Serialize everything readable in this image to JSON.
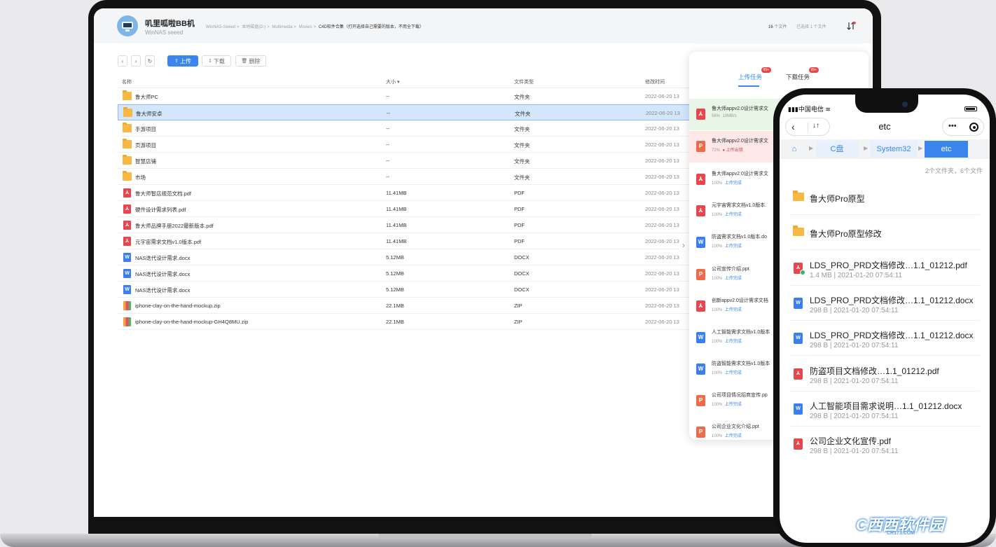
{
  "app": {
    "device_name": "叽里呱啦BB机",
    "device_sub": "WinNAS seeed",
    "breadcrumb": [
      "WinNAS-Seeed",
      "本地磁盘(D:)",
      "Multimedia",
      "Movies"
    ],
    "breadcrumb_current": "C4D软件合集（打开选择自己需要的版本，不用全下载）",
    "file_count_num": "16",
    "file_count_unit": "个文件",
    "selected_text": "已选择 1 个文件"
  },
  "toolbar": {
    "upload_label": "上传",
    "download_label": "下载",
    "delete_label": "删除"
  },
  "table": {
    "headers": {
      "name": "名称",
      "size": "大小 ▾",
      "type": "文件类型",
      "modified": "修改时间"
    },
    "rows": [
      {
        "name": "鲁大师PC",
        "size": "--",
        "type": "文件夹",
        "date": "2022-06-20 13",
        "icon": "folder"
      },
      {
        "name": "鲁大师安卓",
        "size": "--",
        "type": "文件夹",
        "date": "2022-06-20 13",
        "icon": "folder"
      },
      {
        "name": "手游项目",
        "size": "--",
        "type": "文件夹",
        "date": "2022-06-20 13",
        "icon": "folder"
      },
      {
        "name": "页游项目",
        "size": "--",
        "type": "文件夹",
        "date": "2022-06-20 13",
        "icon": "folder"
      },
      {
        "name": "智慧店铺",
        "size": "--",
        "type": "文件夹",
        "date": "2022-06-20 13",
        "icon": "folder"
      },
      {
        "name": "市场",
        "size": "--",
        "type": "文件夹",
        "date": "2022-06-20 13",
        "icon": "folder"
      },
      {
        "name": "鲁大师智店规范文档.pdf",
        "size": "11.41MB",
        "type": "PDF",
        "date": "2022-06-20 13",
        "icon": "pdf"
      },
      {
        "name": "硬件设计需求列表.pdf",
        "size": "11.41MB",
        "type": "PDF",
        "date": "2022-06-20 13",
        "icon": "pdf"
      },
      {
        "name": "鲁大师品牌手册2022最新版本.pdf",
        "size": "11.41MB",
        "type": "PDF",
        "date": "2022-06-20 13",
        "icon": "pdf"
      },
      {
        "name": "元宇宙需求文档v1.0版本.pdf",
        "size": "11.41MB",
        "type": "PDF",
        "date": "2022-06-20 13",
        "icon": "pdf"
      },
      {
        "name": "NAS迭代设计需求.docx",
        "size": "5.12MB",
        "type": "DOCX",
        "date": "2022-06-20 13",
        "icon": "doc"
      },
      {
        "name": "NAS迭代设计需求.docx",
        "size": "5.12MB",
        "type": "DOCX",
        "date": "2022-06-20 13",
        "icon": "doc"
      },
      {
        "name": "NAS迭代设计需求.docx",
        "size": "5.12MB",
        "type": "DOCX",
        "date": "2022-06-20 13",
        "icon": "doc"
      },
      {
        "name": "iphone-clay-on-the-hand-mockup.zip",
        "size": "22.1MB",
        "type": "ZIP",
        "date": "2022-06-20 13",
        "icon": "zip"
      },
      {
        "name": "iphone-clay-on-the-hand-mockup-GH4Q8MU.zip",
        "size": "22.1MB",
        "type": "ZIP",
        "date": "2022-06-20 13",
        "icon": "zip"
      }
    ]
  },
  "transfers": {
    "upload_tab": "上传任务",
    "download_tab": "下载任务",
    "upload_badge": "99+",
    "download_badge": "99+",
    "tasks": [
      {
        "name": "鲁大师appv2.0设计需求文",
        "percent": "56%",
        "extra": "10MB/s",
        "icon": "pdf",
        "state": "ok"
      },
      {
        "name": "鲁大师appv2.0设计需求文",
        "percent": "72%",
        "extra": "上传出错",
        "icon": "ppt",
        "state": "err"
      },
      {
        "name": "鲁大师appv2.0设计需求文",
        "percent": "100%",
        "extra": "上传完成",
        "icon": "pdf",
        "state": "done"
      },
      {
        "name": "元宇宙需求文档v1.0版本.",
        "percent": "100%",
        "extra": "上传完成",
        "icon": "pdf",
        "state": "done"
      },
      {
        "name": "防盗需求文档v1.0版本.do",
        "percent": "100%",
        "extra": "上传完成",
        "icon": "doc",
        "state": "done"
      },
      {
        "name": "公司宣传介绍.ppt",
        "percent": "100%",
        "extra": "上传完成",
        "icon": "ppt",
        "state": "done"
      },
      {
        "name": "创新appv2.0设计需求文档",
        "percent": "100%",
        "extra": "上传完成",
        "icon": "pdf",
        "state": "done"
      },
      {
        "name": "人工智能需求文档v1.0版本",
        "percent": "100%",
        "extra": "上传完成",
        "icon": "doc",
        "state": "done"
      },
      {
        "name": "防盗智能需求文档v1.0版本",
        "percent": "100%",
        "extra": "上传完成",
        "icon": "doc",
        "state": "done"
      },
      {
        "name": "公司项目情况招商宣传.pp",
        "percent": "100%",
        "extra": "上传完成",
        "icon": "ppt",
        "state": "done"
      },
      {
        "name": "公司企业文化介绍.ppt",
        "percent": "100%",
        "extra": "上传完成",
        "icon": "ppt",
        "state": "done"
      }
    ]
  },
  "phone": {
    "carrier": "中国电信",
    "title": "etc",
    "crumbs": [
      "C盘",
      "System32",
      "etc"
    ],
    "count": "2个文件夹，6个文件",
    "items": [
      {
        "name": "鲁大师Pro原型",
        "meta": "",
        "icon": "folder"
      },
      {
        "name": "鲁大师Pro原型修改",
        "meta": "",
        "icon": "folder"
      },
      {
        "name": "LDS_PRO_PRD文档修改…1.1_01212.pdf",
        "meta": "1.4 MB  |  2021-01-20 07:54:11",
        "icon": "pdf",
        "shared": true
      },
      {
        "name": "LDS_PRO_PRD文档修改…1.1_01212.docx",
        "meta": "298 B  |  2021-01-20 07:54:11",
        "icon": "doc"
      },
      {
        "name": "LDS_PRO_PRD文档修改…1.1_01212.docx",
        "meta": "298 B  |  2021-01-20 07:54:11",
        "icon": "doc"
      },
      {
        "name": "防盗项目文档修改…1.1_01212.pdf",
        "meta": "298 B  |  2021-01-20 07:54:11",
        "icon": "pdf"
      },
      {
        "name": "人工智能项目需求说明…1.1_01212.docx",
        "meta": "298 B  |  2021-01-20 07:54:11",
        "icon": "doc"
      },
      {
        "name": "公司企业文化宣传.pdf",
        "meta": "298 B  |  2021-01-20 07:54:11",
        "icon": "pdf"
      }
    ]
  },
  "watermark": {
    "text": "西西软件园",
    "sub": "CR173.COM"
  }
}
